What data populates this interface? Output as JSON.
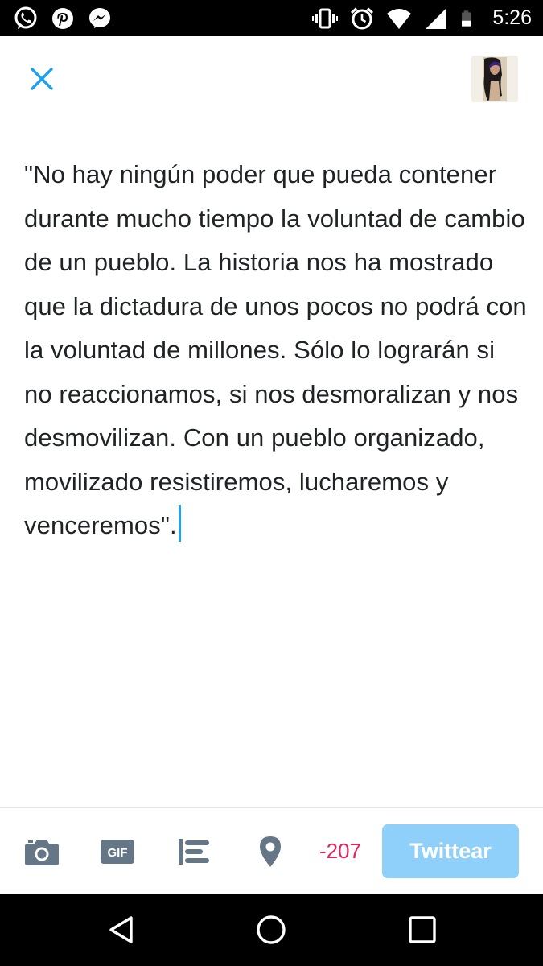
{
  "status_bar": {
    "time": "5:26",
    "left_icons": [
      "whatsapp-icon",
      "pinterest-icon",
      "messenger-icon"
    ],
    "right_icons": [
      "vibrate-icon",
      "alarm-icon",
      "wifi-icon",
      "signal-icon",
      "battery-icon"
    ]
  },
  "header": {
    "close_icon": "close-icon",
    "avatar": "profile-avatar"
  },
  "compose": {
    "text": "\"No hay ningún poder que pueda contener durante mucho tiempo la voluntad de cambio de un pueblo. La historia nos ha mostrado que la dictadura de unos pocos no podrá con la voluntad de millones. Sólo lo lograrán si no reaccionamos, si nos desmoralizan y nos desmovilizan. Con un pueblo organizado, movilizado resistiremos, lucharemos y venceremos\"."
  },
  "toolbar": {
    "icons": [
      "camera-icon",
      "gif-icon",
      "poll-icon",
      "location-icon"
    ],
    "gif_label": "GIF",
    "char_counter": "-207",
    "tweet_label": "Twittear"
  },
  "nav_bar": {
    "icons": [
      "back-icon",
      "home-icon",
      "recents-icon"
    ]
  },
  "colors": {
    "accent": "#1da1f2",
    "tweet_button_disabled": "#8ed0f9",
    "counter_negative": "#e0245e",
    "toolbar_icon": "#657786",
    "text": "#1f2326"
  }
}
